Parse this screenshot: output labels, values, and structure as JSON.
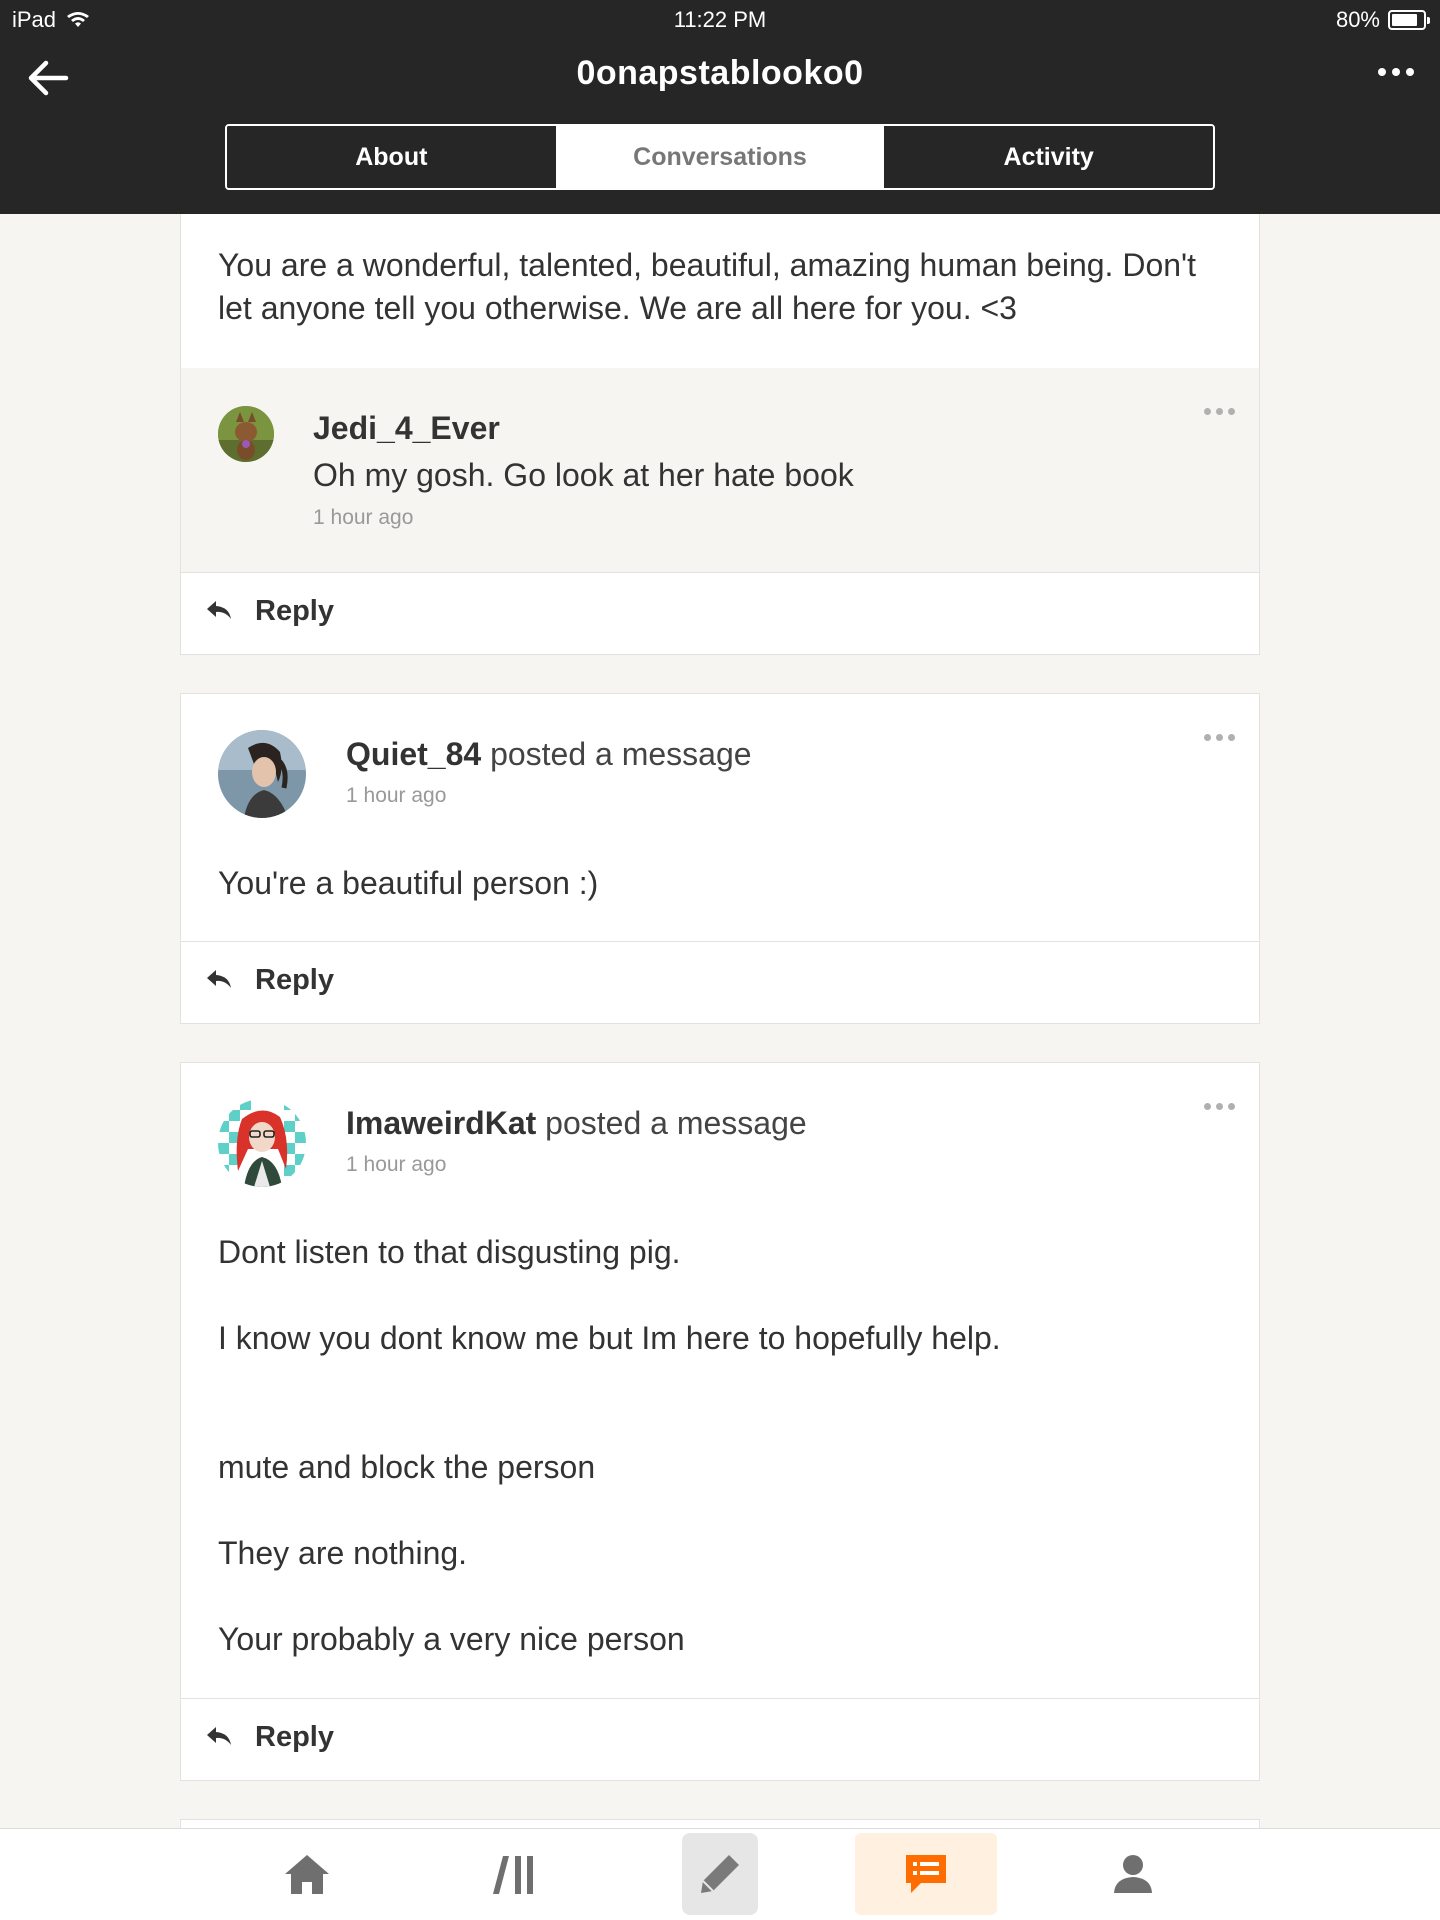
{
  "status_bar": {
    "device": "iPad",
    "time": "11:22 PM",
    "battery": "80%",
    "battery_level": 0.8
  },
  "header": {
    "title": "0onapstablooko0",
    "tabs": [
      {
        "label": "About",
        "active": false
      },
      {
        "label": "Conversations",
        "active": true
      },
      {
        "label": "Activity",
        "active": false
      }
    ]
  },
  "posts": [
    {
      "text": "You are a wonderful, talented, beautiful, amazing human being. Don't let anyone tell you otherwise. We are all here for you. <3",
      "reply": {
        "username": "Jedi_4_Ever",
        "text": "Oh my gosh. Go look at her hate book",
        "time": "1 hour ago"
      },
      "reply_label": "Reply"
    },
    {
      "username": "Quiet_84",
      "action": " posted a message",
      "time": "1 hour ago",
      "lines": [
        "You're a beautiful person :)"
      ],
      "reply_label": "Reply"
    },
    {
      "username": "ImaweirdKat",
      "action": " posted a message",
      "time": "1 hour ago",
      "lines": [
        "Dont listen to that disgusting pig.",
        "I know you dont know me but Im here to hopefully help.",
        "mute and block the person",
        "They are nothing.",
        "Your probably a very nice person"
      ],
      "reply_label": "Reply"
    }
  ],
  "bottom_nav": {
    "items": [
      "home-icon",
      "library-icon",
      "write-icon",
      "conversations-icon",
      "profile-icon"
    ],
    "active": "conversations-icon",
    "accent": "#ff6d00",
    "accent_bg": "#fff0e0"
  }
}
